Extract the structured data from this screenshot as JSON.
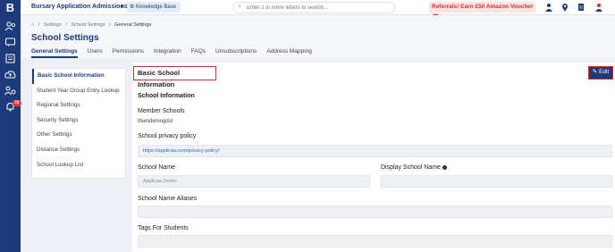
{
  "rail": {
    "logo": "B",
    "notification_count": "39"
  },
  "topbar": {
    "app_selector": "Bursary Application Admissions Y...",
    "knowledge_base": "Knowledge Base",
    "search_placeholder": "Enter 2 or more letters to search...",
    "referral": "Referrals! Earn £50 Amazon Voucher"
  },
  "breadcrumb": [
    "Settings",
    "School Settings",
    "General Settings"
  ],
  "page_title": "School Settings",
  "tabs": [
    "General Settings",
    "Users",
    "Permissions",
    "Integration",
    "FAQs",
    "Unsubscriptions",
    "Address Mapping"
  ],
  "side_menu": [
    "Basic School Information",
    "Student Year Group Entry Lookup",
    "Regional Settings",
    "Security Settings",
    "Other Settings",
    "Distance Settings",
    "School Lookup List"
  ],
  "panel": {
    "title": "Basic School Information",
    "edit_label": "Edit",
    "school_info_heading": "School Information",
    "member_schools_label": "Member Schools",
    "member_schools_value": "thiendemogdst",
    "privacy_policy_label": "School privacy policy",
    "privacy_policy_value": "https://applicaa.com/privacy-policy/",
    "school_name_label": "School Name",
    "school_name_value": "Applicaa Demo",
    "display_name_label": "Display School Name",
    "aliases_label": "School Name Aliases",
    "tags_label": "Tags For Students"
  },
  "colors": {
    "brand": "#1d3a7a",
    "highlight": "#d32f2f",
    "link": "#2d6cc0"
  }
}
